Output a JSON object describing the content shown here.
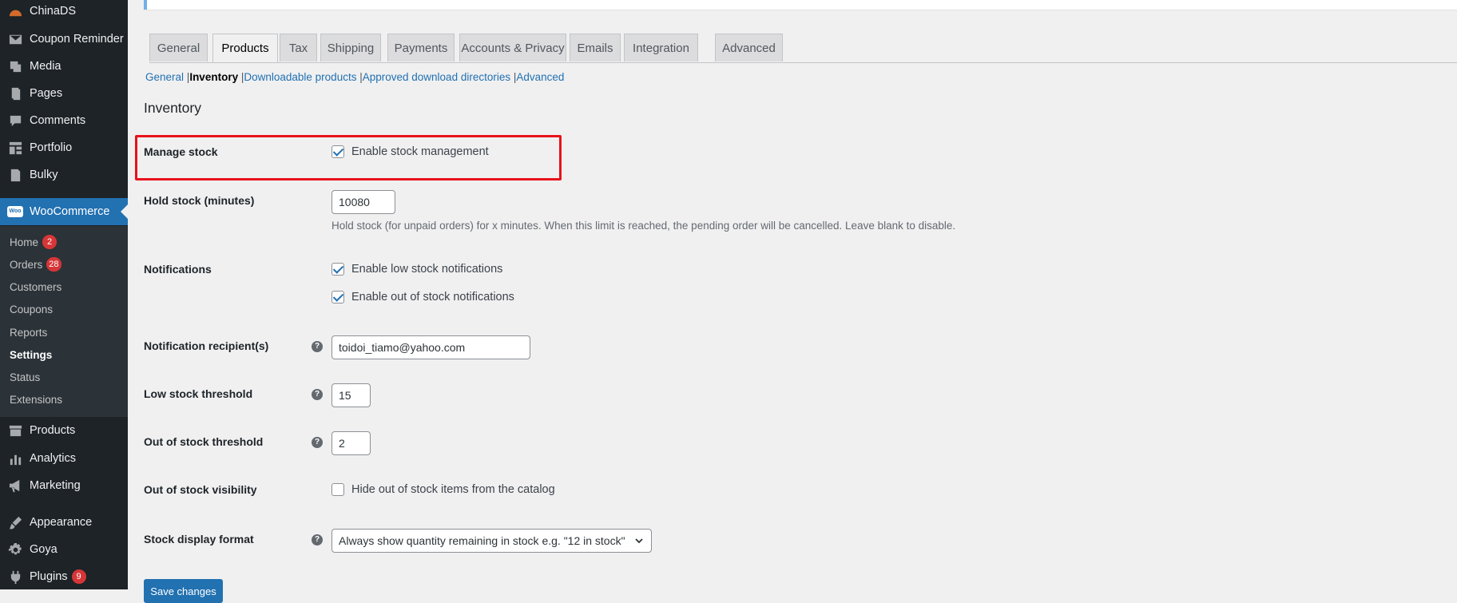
{
  "sidebar": {
    "menu_top": [
      {
        "label": "ChinaDS",
        "icon": "chinads-icon"
      },
      {
        "label": "Coupon Reminder",
        "icon": "envelope-icon"
      },
      {
        "label": "Media",
        "icon": "media-icon"
      },
      {
        "label": "Pages",
        "icon": "pages-icon"
      },
      {
        "label": "Comments",
        "icon": "comments-icon"
      },
      {
        "label": "Portfolio",
        "icon": "portfolio-icon"
      },
      {
        "label": "Bulky",
        "icon": "document-icon"
      },
      {
        "label": "WooCommerce",
        "icon": "woocommerce-icon"
      }
    ],
    "submenu": [
      {
        "label": "Home",
        "badge": "2"
      },
      {
        "label": "Orders",
        "badge": "28"
      },
      {
        "label": "Customers"
      },
      {
        "label": "Coupons"
      },
      {
        "label": "Reports"
      },
      {
        "label": "Settings",
        "active": true
      },
      {
        "label": "Status"
      },
      {
        "label": "Extensions"
      }
    ],
    "menu_bottom": [
      {
        "label": "Products",
        "icon": "archive-icon"
      },
      {
        "label": "Analytics",
        "icon": "analytics-icon"
      },
      {
        "label": "Marketing",
        "icon": "megaphone-icon"
      },
      {
        "label": "Appearance",
        "icon": "paintbrush-icon"
      },
      {
        "label": "Goya",
        "icon": "gear-icon"
      },
      {
        "label": "Plugins",
        "icon": "plugin-icon",
        "badge": "9"
      }
    ],
    "woo_logo_text": "Woo",
    "accent_color": "#2271b1"
  },
  "tabs": [
    "General",
    "Products",
    "Tax",
    "Shipping",
    "Payments",
    "Accounts & Privacy",
    "Emails",
    "Integration",
    "Advanced"
  ],
  "active_tab": "Products",
  "sections": [
    {
      "label": "General",
      "current": false
    },
    {
      "label": "Inventory",
      "current": true
    },
    {
      "label": "Downloadable products",
      "current": false
    },
    {
      "label": "Approved download directories",
      "current": false
    },
    {
      "label": "Advanced",
      "current": false
    }
  ],
  "page_title": "Inventory",
  "manage_stock": {
    "label": "Manage stock",
    "checkbox_label": "Enable stock management",
    "checked": true
  },
  "hold_stock": {
    "label": "Hold stock (minutes)",
    "value": "10080",
    "description": "Hold stock (for unpaid orders) for x minutes. When this limit is reached, the pending order will be cancelled. Leave blank to disable."
  },
  "notifications": {
    "label": "Notifications",
    "low_stock_label": "Enable low stock notifications",
    "low_stock_checked": true,
    "out_of_stock_label": "Enable out of stock notifications",
    "out_of_stock_checked": true
  },
  "recipient": {
    "label": "Notification recipient(s)",
    "value": "toidoi_tiamo@yahoo.com"
  },
  "low_stock_threshold": {
    "label": "Low stock threshold",
    "value": "15"
  },
  "out_of_stock_threshold": {
    "label": "Out of stock threshold",
    "value": "2"
  },
  "visibility": {
    "label": "Out of stock visibility",
    "checkbox_label": "Hide out of stock items from the catalog",
    "checked": false
  },
  "stock_display": {
    "label": "Stock display format",
    "selected": "Always show quantity remaining in stock e.g. \"12 in stock\""
  },
  "help_tip_glyph": "?",
  "save_button": "Save changes",
  "highlight_color": "#e8121b"
}
